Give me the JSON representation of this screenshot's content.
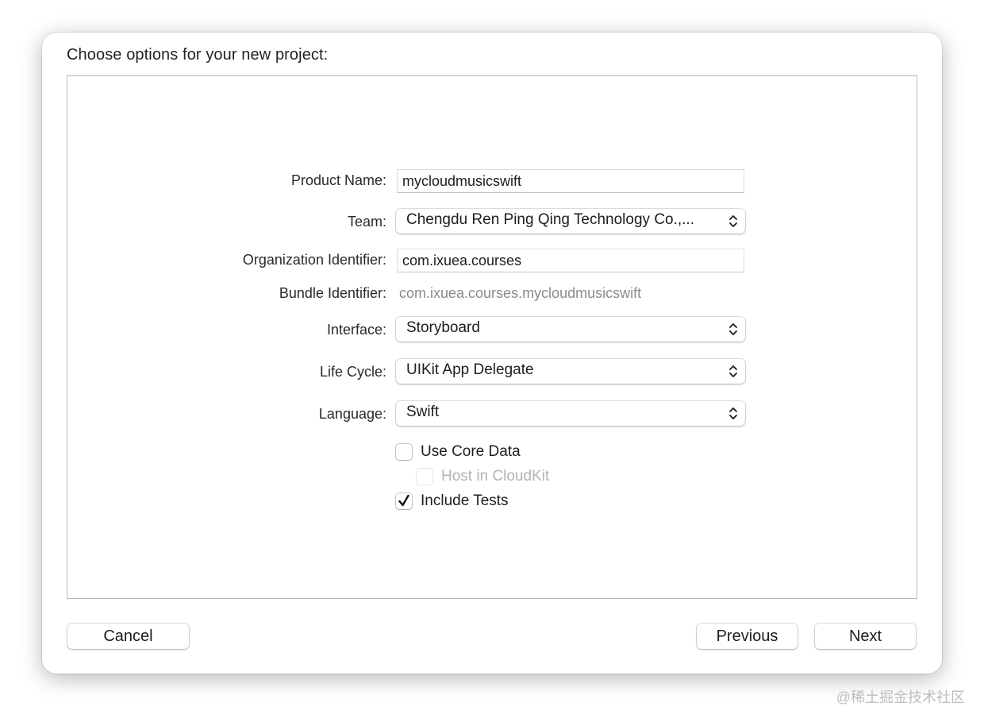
{
  "dialog": {
    "title": "Choose options for your new project:"
  },
  "form": {
    "product_name": {
      "label": "Product Name:",
      "value": "mycloudmusicswift"
    },
    "team": {
      "label": "Team:",
      "value": "Chengdu Ren Ping Qing Technology Co.,..."
    },
    "organization_identifier": {
      "label": "Organization Identifier:",
      "value": "com.ixuea.courses"
    },
    "bundle_identifier": {
      "label": "Bundle Identifier:",
      "value": "com.ixuea.courses.mycloudmusicswift"
    },
    "interface": {
      "label": "Interface:",
      "value": "Storyboard"
    },
    "life_cycle": {
      "label": "Life Cycle:",
      "value": "UIKit App Delegate"
    },
    "language": {
      "label": "Language:",
      "value": "Swift"
    }
  },
  "options": {
    "use_core_data": {
      "label": "Use Core Data",
      "checked": false,
      "enabled": true
    },
    "host_in_cloudkit": {
      "label": "Host in CloudKit",
      "checked": false,
      "enabled": false
    },
    "include_tests": {
      "label": "Include Tests",
      "checked": true,
      "enabled": true
    }
  },
  "buttons": {
    "cancel": "Cancel",
    "previous": "Previous",
    "next": "Next"
  },
  "watermark": "@稀土掘金技术社区",
  "icons": {
    "popup_arrows": "chevron-up-down-icon",
    "checkmark": "checkmark-icon"
  }
}
